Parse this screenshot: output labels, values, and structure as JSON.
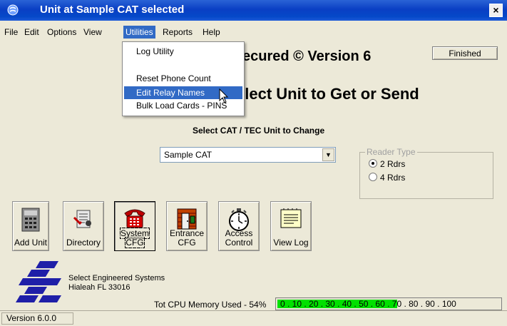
{
  "window": {
    "title": "Unit at Sample CAT selected",
    "close_glyph": "×"
  },
  "menu": {
    "items": [
      "File",
      "Edit",
      "Options",
      "View",
      "Utilities",
      "Reports",
      "Help"
    ],
    "active": "Utilities"
  },
  "utilities_menu": {
    "items": [
      "Log Utility",
      "Reset Phone Count",
      "Edit Relay Names",
      "Bulk Load Cards - PINS"
    ],
    "highlighted": "Edit Relay Names"
  },
  "main": {
    "app_title": "ecured © Version 6",
    "finished_button": "Finished",
    "heading": "elect Unit to Get or Send",
    "select_label": "Select CAT / TEC Unit to Change",
    "unit_combo_value": "Sample CAT"
  },
  "reader_type": {
    "legend": "Reader Type",
    "options": [
      "2 Rdrs",
      "4 Rdrs"
    ],
    "selected": "2 Rdrs"
  },
  "toolbar": {
    "add_unit": "Add Unit",
    "directory": "Directory",
    "system_cfg_line1": "System",
    "system_cfg_line2": "CFG",
    "entrance_cfg_line1": "Entrance",
    "entrance_cfg_line2": "CFG",
    "access_control_line1": "Access",
    "access_control_line2": "Control",
    "view_log": "View Log"
  },
  "company": {
    "name": "Select Engineered Systems",
    "location": "Hialeah FL 33016"
  },
  "cpu": {
    "label": "Tot CPU Memory Used - 54%",
    "percent": 54,
    "scale": "0 . 10 . 20 . 30 . 40 . 50 . 60 . 70 . 80 . 90 . 100",
    "fill_color": "#00e000"
  },
  "status": {
    "version": "Version 6.0.0"
  },
  "icons": [
    "app-icon",
    "close-icon",
    "keypad-icon",
    "directory-icon",
    "telephone-icon",
    "entrance-door-icon",
    "stopwatch-icon",
    "log-notepad-icon",
    "ses-logo",
    "mouse-cursor-icon"
  ]
}
